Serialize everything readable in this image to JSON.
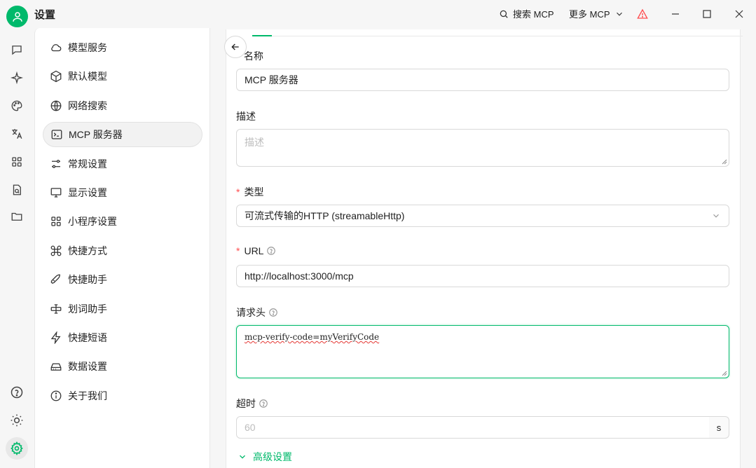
{
  "app": {
    "title": "设置"
  },
  "titlebar": {
    "search_mcp": "搜索 MCP",
    "more_mcp": "更多 MCP"
  },
  "rail": {
    "icons": [
      "chat-icon",
      "sparkle-icon",
      "palette-icon",
      "translate-icon",
      "apps-grid-icon",
      "document-scan-icon",
      "folder-icon",
      "help-icon",
      "theme-toggle-icon",
      "settings-icon"
    ]
  },
  "nav": {
    "items": [
      {
        "label": "模型服务",
        "icon": "cloud-icon"
      },
      {
        "label": "默认模型",
        "icon": "cube-icon"
      },
      {
        "label": "网络搜索",
        "icon": "globe-icon"
      },
      {
        "label": "MCP 服务器",
        "icon": "terminal-icon",
        "active": true
      },
      {
        "label": "常规设置",
        "icon": "sliders-icon"
      },
      {
        "label": "显示设置",
        "icon": "monitor-icon"
      },
      {
        "label": "小程序设置",
        "icon": "grid-icon"
      },
      {
        "label": "快捷方式",
        "icon": "command-icon"
      },
      {
        "label": "快捷助手",
        "icon": "rocket-icon"
      },
      {
        "label": "划词助手",
        "icon": "text-cursor-icon"
      },
      {
        "label": "快捷短语",
        "icon": "zap-icon"
      },
      {
        "label": "数据设置",
        "icon": "hard-drive-icon"
      },
      {
        "label": "关于我们",
        "icon": "info-icon"
      }
    ]
  },
  "form": {
    "name_label": "名称",
    "name_value": "MCP 服务器",
    "desc_label": "描述",
    "desc_placeholder": "描述",
    "type_label": "类型",
    "type_value": "可流式传输的HTTP (streamableHttp)",
    "url_label": "URL",
    "url_value": "http://localhost:3000/mcp",
    "headers_label": "请求头",
    "headers_value": "mcp-verify-code=myVerifyCode",
    "timeout_label": "超时",
    "timeout_placeholder": "60",
    "timeout_unit": "s",
    "advanced_label": "高级设置",
    "required_mark": "*"
  },
  "colors": {
    "accent": "#00b96b",
    "required": "#ff4d4f",
    "warning": "#ff4d4f"
  }
}
